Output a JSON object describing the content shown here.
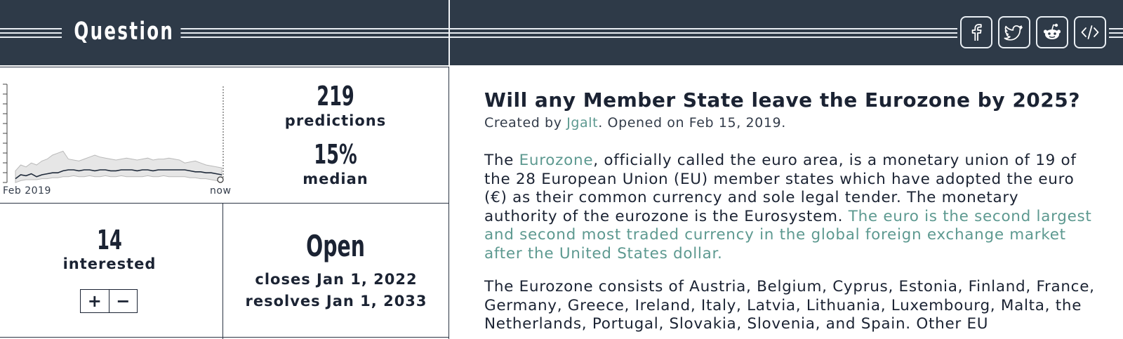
{
  "header": {
    "title": "Question",
    "social": [
      {
        "icon": "facebook-icon"
      },
      {
        "icon": "twitter-icon"
      },
      {
        "icon": "reddit-icon"
      },
      {
        "icon": "embed-icon"
      }
    ]
  },
  "stats": {
    "predictions_count": "219",
    "predictions_label": "predictions",
    "median_value": "15%",
    "median_label": "median",
    "interested_count": "14",
    "interested_label": "interested",
    "plus_label": "+",
    "minus_label": "−",
    "status": "Open",
    "closes": "closes Jan 1, 2022",
    "resolves": "resolves Jan 1, 2033"
  },
  "chart_data": {
    "type": "area",
    "x_start_label": "Feb 2019",
    "x_end_label": "now",
    "median": [
      0.06,
      0.1,
      0.09,
      0.11,
      0.08,
      0.1,
      0.11,
      0.12,
      0.12,
      0.14,
      0.15,
      0.15,
      0.14,
      0.15,
      0.15,
      0.14,
      0.15,
      0.15,
      0.14,
      0.14,
      0.15,
      0.15,
      0.15,
      0.14,
      0.15,
      0.15,
      0.14,
      0.15,
      0.15,
      0.15,
      0.15,
      0.15,
      0.15,
      0.14,
      0.13,
      0.13,
      0.12,
      0.12,
      0.11,
      0.1
    ],
    "upper": [
      0.14,
      0.2,
      0.18,
      0.22,
      0.2,
      0.24,
      0.26,
      0.3,
      0.32,
      0.34,
      0.26,
      0.25,
      0.24,
      0.26,
      0.28,
      0.3,
      0.28,
      0.27,
      0.26,
      0.25,
      0.26,
      0.27,
      0.26,
      0.25,
      0.26,
      0.27,
      0.25,
      0.26,
      0.26,
      0.27,
      0.26,
      0.25,
      0.22,
      0.23,
      0.24,
      0.22,
      0.2,
      0.19,
      0.18,
      0.17
    ],
    "lower": [
      0.02,
      0.04,
      0.05,
      0.05,
      0.05,
      0.06,
      0.06,
      0.07,
      0.07,
      0.08,
      0.08,
      0.09,
      0.08,
      0.08,
      0.09,
      0.08,
      0.08,
      0.09,
      0.08,
      0.08,
      0.09,
      0.08,
      0.08,
      0.08,
      0.08,
      0.09,
      0.08,
      0.08,
      0.09,
      0.08,
      0.08,
      0.08,
      0.08,
      0.07,
      0.07,
      0.06,
      0.06,
      0.05,
      0.04,
      0.03
    ]
  },
  "question": {
    "title": "Will any Member State leave the Eurozone by 2025?",
    "created_prefix": "Created by ",
    "author": "Jgalt",
    "created_suffix": ". Opened on Feb 15, 2019.",
    "p1_pre": "The ",
    "p1_link": "Eurozone",
    "p1_mid": ", officially called the euro area, is a monetary union of 19 of the 28 European Union (EU) member states which have adopted the euro (€) as their common currency and sole legal tender. The monetary authority of the eurozone is the Eurosystem. ",
    "p1_teal": "The euro is the second largest and second most traded currency in the global foreign exchange market after the United States dollar.",
    "p2": "The Eurozone consists of Austria, Belgium, Cyprus, Estonia, Finland, France, Germany, Greece, Ireland, Italy, Latvia, Lithuania, Luxembourg, Malta, the Netherlands, Portugal, Slovakia, Slovenia, and Spain. Other EU"
  },
  "colors": {
    "header_bg": "#2e3a48",
    "accent_teal": "#5d9990",
    "band_fill": "#e6e6e6",
    "band_stroke": "#b9b9b9"
  }
}
